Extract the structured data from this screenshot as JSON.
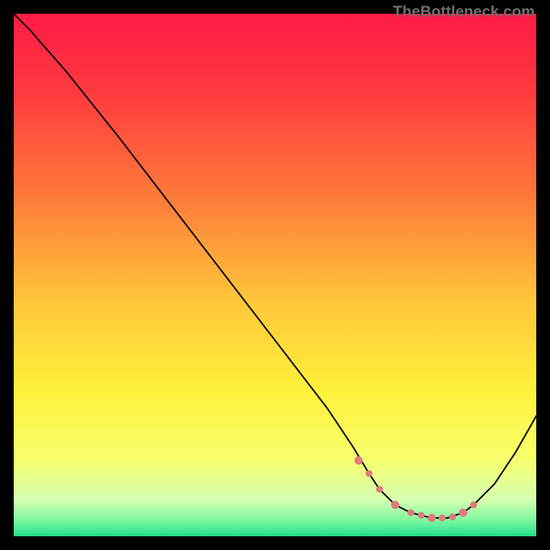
{
  "watermark": "TheBottleneck.com",
  "chart_data": {
    "type": "line",
    "title": "",
    "xlabel": "",
    "ylabel": "",
    "xlim": [
      0,
      100
    ],
    "ylim": [
      0,
      100
    ],
    "grid": false,
    "legend": false,
    "series": [
      {
        "name": "curve",
        "x": [
          0,
          3,
          10,
          20,
          30,
          40,
          50,
          60,
          65,
          68,
          70,
          73,
          76,
          80,
          83,
          86,
          88,
          92,
          96,
          100
        ],
        "y": [
          100,
          97,
          89,
          76.5,
          63.5,
          50.5,
          37.5,
          24.5,
          17,
          12,
          9,
          6,
          4.5,
          3.5,
          3.5,
          4.5,
          6,
          10,
          16,
          23
        ]
      }
    ],
    "markers": {
      "name": "highlight-dots",
      "color": "#e07a7a",
      "x": [
        66,
        68,
        70,
        73,
        76,
        78,
        80,
        82,
        84,
        86,
        88
      ],
      "y": [
        14.5,
        12,
        9,
        6,
        4.5,
        4,
        3.5,
        3.5,
        3.7,
        4.5,
        6
      ]
    },
    "background_gradient": {
      "stops": [
        {
          "offset": 0.0,
          "color": "#ff1a46"
        },
        {
          "offset": 0.15,
          "color": "#ff3a3f"
        },
        {
          "offset": 0.35,
          "color": "#ff7a3a"
        },
        {
          "offset": 0.55,
          "color": "#ffc63a"
        },
        {
          "offset": 0.72,
          "color": "#fff13a"
        },
        {
          "offset": 0.85,
          "color": "#f7ff6a"
        },
        {
          "offset": 0.93,
          "color": "#d6ffb0"
        },
        {
          "offset": 0.97,
          "color": "#7cf7a0"
        },
        {
          "offset": 1.0,
          "color": "#22e08a"
        }
      ]
    }
  }
}
